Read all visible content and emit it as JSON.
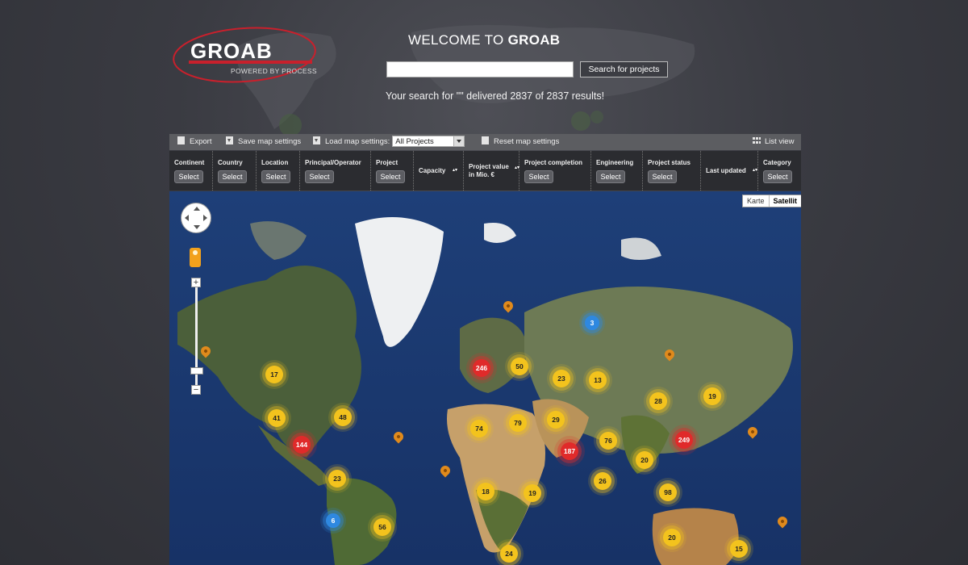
{
  "header": {
    "logo_text": "GROAB",
    "logo_sub": "POWERED BY PROCESS",
    "welcome_prefix": "WELCOME TO ",
    "welcome_brand": "GROAB",
    "search_value": "",
    "search_button": "Search for projects",
    "result_text": "Your search for \"\" delivered 2837 of 2837 results!"
  },
  "toolbar": {
    "export": "Export",
    "save": "Save map settings",
    "load": "Load map settings:",
    "load_value": "All Projects",
    "reset": "Reset map settings",
    "list_view": "List view"
  },
  "filters": [
    {
      "label": "Continent",
      "button": "Select"
    },
    {
      "label": "Country",
      "button": "Select"
    },
    {
      "label": "Location",
      "button": "Select"
    },
    {
      "label": "Principal/Operator",
      "button": "Select"
    },
    {
      "label": "Project",
      "button": "Select"
    },
    {
      "label": "Capacity",
      "button": ""
    },
    {
      "label": "Project value",
      "label2": "in Mio. €",
      "button": ""
    },
    {
      "label": "Project completion",
      "button": "Select"
    },
    {
      "label": "Engineering",
      "button": "Select"
    },
    {
      "label": "Project status",
      "button": "Select"
    },
    {
      "label": "Last updated",
      "button": ""
    },
    {
      "label": "Category",
      "button": "Select"
    }
  ],
  "map": {
    "type_karte": "Karte",
    "type_satellit": "Satellit",
    "zoom_in": "+",
    "zoom_out": "−",
    "clusters": [
      {
        "value": "17",
        "color": "yellow"
      },
      {
        "value": "41",
        "color": "yellow"
      },
      {
        "value": "48",
        "color": "yellow"
      },
      {
        "value": "144",
        "color": "red"
      },
      {
        "value": "23",
        "color": "yellow"
      },
      {
        "value": "6",
        "color": "blue"
      },
      {
        "value": "56",
        "color": "yellow"
      },
      {
        "value": "246",
        "color": "red"
      },
      {
        "value": "50",
        "color": "yellow"
      },
      {
        "value": "3",
        "color": "blue"
      },
      {
        "value": "23",
        "color": "yellow"
      },
      {
        "value": "13",
        "color": "yellow"
      },
      {
        "value": "28",
        "color": "yellow"
      },
      {
        "value": "19",
        "color": "yellow"
      },
      {
        "value": "74",
        "color": "yellow"
      },
      {
        "value": "79",
        "color": "yellow"
      },
      {
        "value": "29",
        "color": "yellow"
      },
      {
        "value": "187",
        "color": "red"
      },
      {
        "value": "76",
        "color": "yellow"
      },
      {
        "value": "249",
        "color": "red"
      },
      {
        "value": "20",
        "color": "yellow"
      },
      {
        "value": "18",
        "color": "yellow"
      },
      {
        "value": "19",
        "color": "yellow"
      },
      {
        "value": "26",
        "color": "yellow"
      },
      {
        "value": "98",
        "color": "yellow"
      },
      {
        "value": "20",
        "color": "yellow"
      },
      {
        "value": "24",
        "color": "yellow"
      },
      {
        "value": "15",
        "color": "yellow"
      }
    ]
  },
  "colors": {
    "brand_red": "#c8202c",
    "cluster_yellow": "#f3c31d",
    "cluster_red": "#e02a2a",
    "cluster_blue": "#2e88e0",
    "pin_orange": "#e08a1c"
  }
}
